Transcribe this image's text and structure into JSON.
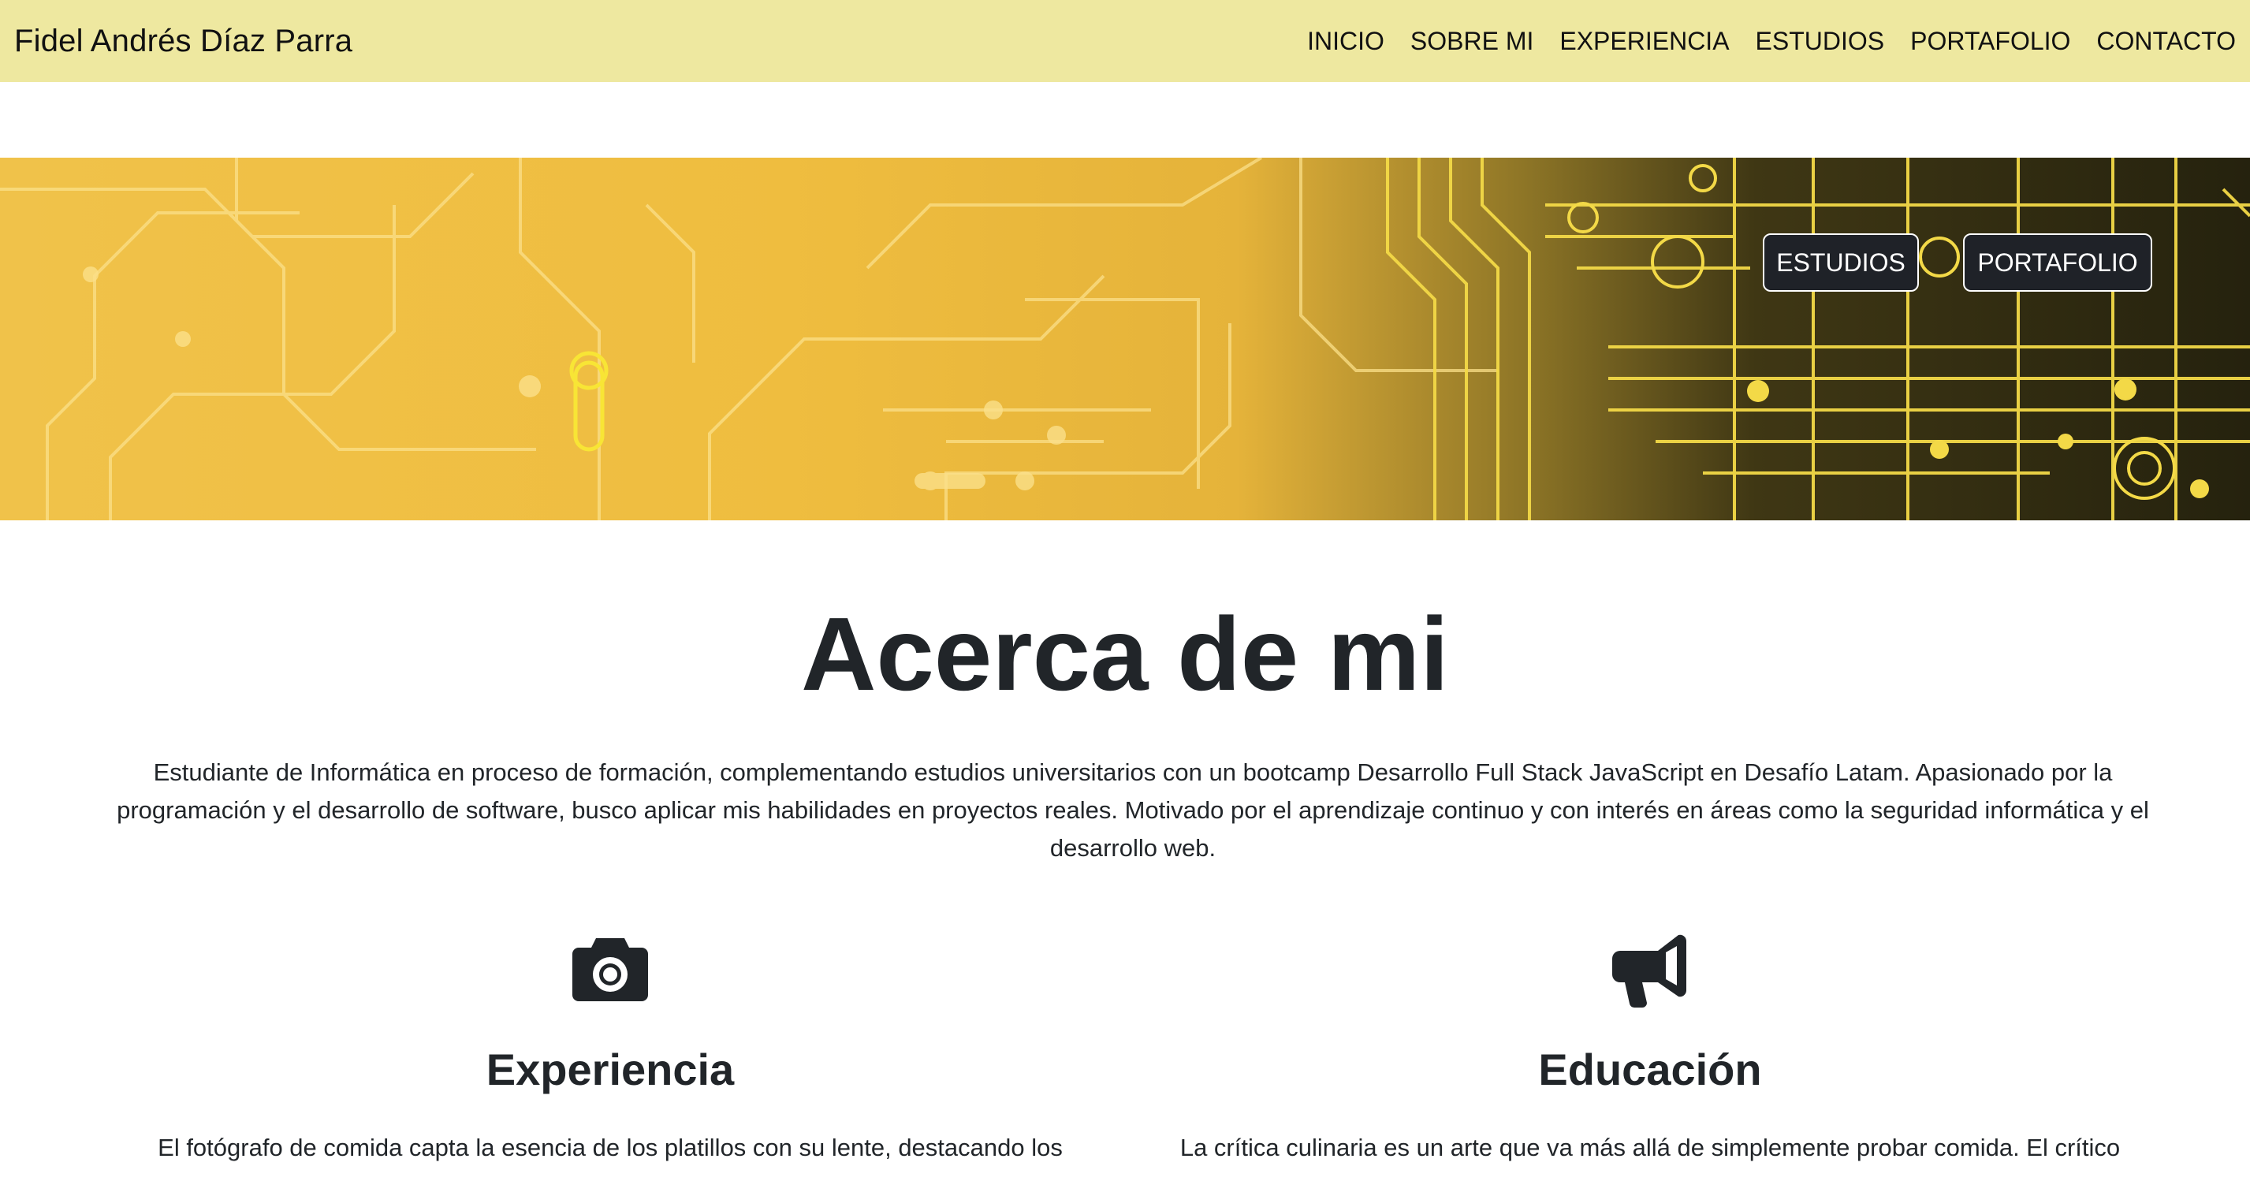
{
  "navbar": {
    "brand": "Fidel Andrés Díaz Parra",
    "links": [
      "INICIO",
      "SOBRE MI",
      "EXPERIENCIA",
      "ESTUDIOS",
      "PORTAFOLIO",
      "CONTACTO"
    ],
    "background": "#eee8a0"
  },
  "hero": {
    "buttons": [
      "ESTUDIOS",
      "PORTAFOLIO"
    ],
    "image": "circuit-board-banner"
  },
  "about": {
    "title": "Acerca de mi",
    "text": "Estudiante de Informática en proceso de formación, complementando estudios universitarios con un bootcamp Desarrollo Full Stack JavaScript en Desafío Latam. Apasionado por la programación y el desarrollo de software, busco aplicar mis habilidades en proyectos reales. Motivado por el aprendizaje continuo y con interés en áreas como la seguridad informática y el desarrollo web."
  },
  "features": [
    {
      "icon": "camera-icon",
      "title": "Experiencia",
      "text": "El fotógrafo de comida capta la esencia de los platillos con su lente, destacando los"
    },
    {
      "icon": "megaphone-icon",
      "title": "Educación",
      "text": "La crítica culinaria es un arte que va más allá de simplemente probar comida. El crítico"
    }
  ]
}
